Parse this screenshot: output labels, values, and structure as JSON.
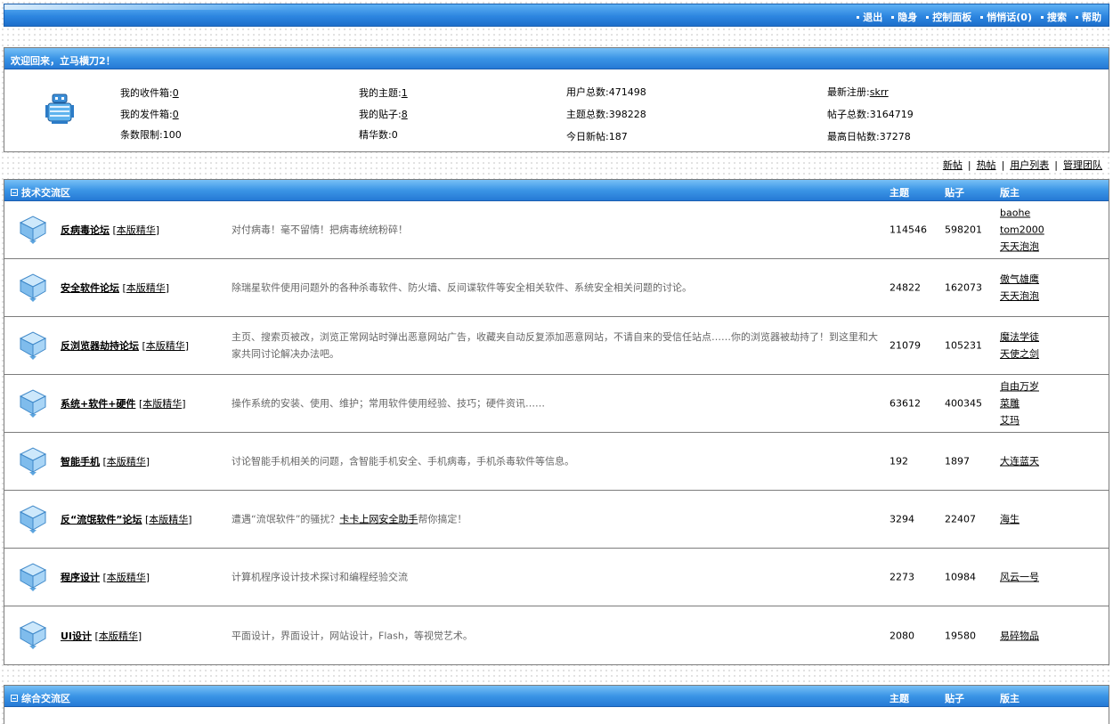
{
  "topnav": [
    "退出",
    "隐身",
    "控制面板",
    "悄悄话(0)",
    "搜索",
    "帮助"
  ],
  "welcome": {
    "title": "欢迎回来，立马横刀2！",
    "inbox_label": "我的收件箱:",
    "inbox_value": "0",
    "outbox_label": "我的发件箱:",
    "outbox_value": "0",
    "limit_label": "条数限制:",
    "limit_value": "100",
    "topics_label": "我的主题:",
    "topics_value": "1",
    "posts_label": "我的贴子:",
    "posts_value": "8",
    "elite_label": "精华数:",
    "elite_value": "0",
    "users_label": "用户总数:",
    "users_value": "471498",
    "totaltopics_label": "主题总数:",
    "totaltopics_value": "398228",
    "today_label": "今日新帖:",
    "today_value": "187",
    "newest_label": "最新注册:",
    "newest_value": "skrr",
    "totalposts_label": "帖子总数:",
    "totalposts_value": "3164719",
    "maxday_label": "最高日帖数:",
    "maxday_value": "37278"
  },
  "quicklinks": [
    "新帖",
    "热帖",
    "用户列表",
    "管理团队"
  ],
  "columns": {
    "topics": "主题",
    "posts": "贴子",
    "mods": "版主"
  },
  "zone1": {
    "title": "技术交流区",
    "forums": [
      {
        "name": "反病毒论坛",
        "elite": "本版精华",
        "desc": "对付病毒！毫不留情！把病毒统统粉碎！",
        "topics": "114546",
        "posts": "598201",
        "mods": [
          "baohe",
          "tom2000",
          "天天泡泡"
        ]
      },
      {
        "name": "安全软件论坛",
        "elite": "本版精华",
        "desc": "除瑞星软件使用问题外的各种杀毒软件、防火墙、反间谍软件等安全相关软件、系统安全相关问题的讨论。",
        "topics": "24822",
        "posts": "162073",
        "mods": [
          "傲气雄鹰",
          "天天泡泡"
        ]
      },
      {
        "name": "反浏览器劫持论坛",
        "elite": "本版精华",
        "desc": "主页、搜索页被改，浏览正常网站时弹出恶意网站广告，收藏夹自动反复添加恶意网站，不请自来的受信任站点……你的浏览器被劫持了！到这里和大家共同讨论解决办法吧。",
        "topics": "21079",
        "posts": "105231",
        "mods": [
          "魔法学徒",
          "天使之剑"
        ]
      },
      {
        "name": "系统+软件+硬件",
        "elite": "本版精华",
        "desc": "操作系统的安装、使用、维护；常用软件使用经验、技巧；硬件资讯……",
        "topics": "63612",
        "posts": "400345",
        "mods": [
          "自由万岁",
          "菜雕",
          "艾玛"
        ]
      },
      {
        "name": "智能手机",
        "elite": "本版精华",
        "desc": "讨论智能手机相关的问题，含智能手机安全、手机病毒，手机杀毒软件等信息。",
        "topics": "192",
        "posts": "1897",
        "mods": [
          "大连蓝天"
        ]
      },
      {
        "name": "反“流氓软件”论坛",
        "elite": "本版精华",
        "desc_pre": "遭遇“流氓软件”的骚扰？",
        "desc_link": "卡卡上网安全助手",
        "desc_post": "帮你搞定！",
        "topics": "3294",
        "posts": "22407",
        "mods": [
          "海生"
        ]
      },
      {
        "name": "程序设计",
        "elite": "本版精华",
        "desc": "计算机程序设计技术探讨和编程经验交流",
        "topics": "2273",
        "posts": "10984",
        "mods": [
          "风云一号"
        ]
      },
      {
        "name": "UI设计",
        "elite": "本版精华",
        "desc": "平面设计，界面设计，网站设计，Flash，等视觉艺术。",
        "topics": "2080",
        "posts": "19580",
        "mods": [
          "易碎物品"
        ]
      }
    ]
  },
  "zone2": {
    "title": "综合交流区"
  }
}
